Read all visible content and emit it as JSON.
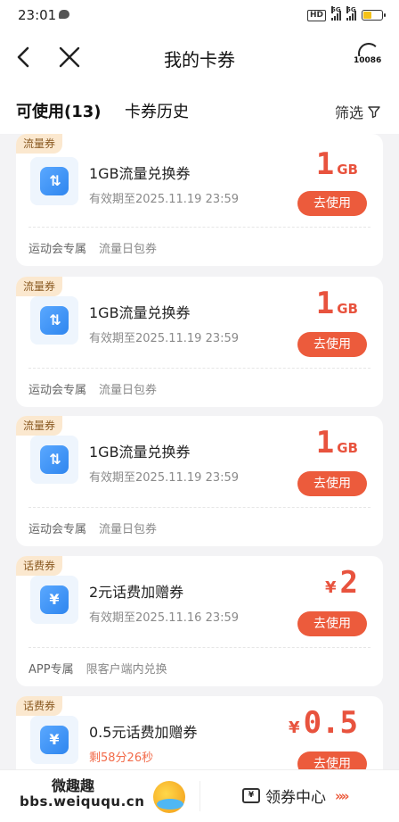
{
  "status_bar": {
    "time": "23:01",
    "hd": "HD",
    "sig1": "5G",
    "sig2": "5G"
  },
  "header": {
    "title": "我的卡券",
    "service_number": "10086"
  },
  "tabs": {
    "active": "可使用(13)",
    "history": "卡券历史",
    "filter": "筛选"
  },
  "cards": [
    {
      "badge": "流量券",
      "icon": "data-transfer-icon",
      "name": "1GB流量兑换券",
      "expiry": "有效期至2025.11.19 23:59",
      "amount": "1",
      "unit": "GB",
      "currency": "",
      "button": "去使用",
      "tag1": "运动会专属",
      "tag2": "流量日包券"
    },
    {
      "badge": "流量券",
      "icon": "data-transfer-icon",
      "name": "1GB流量兑换券",
      "expiry": "有效期至2025.11.19 23:59",
      "amount": "1",
      "unit": "GB",
      "currency": "",
      "button": "去使用",
      "tag1": "运动会专属",
      "tag2": "流量日包券"
    },
    {
      "badge": "流量券",
      "icon": "data-transfer-icon",
      "name": "1GB流量兑换券",
      "expiry": "有效期至2025.11.19 23:59",
      "amount": "1",
      "unit": "GB",
      "currency": "",
      "button": "去使用",
      "tag1": "运动会专属",
      "tag2": "流量日包券"
    },
    {
      "badge": "话费券",
      "icon": "yen-icon",
      "name": "2元话费加赠券",
      "expiry": "有效期至2025.11.16 23:59",
      "amount": "2",
      "unit": "",
      "currency": "¥",
      "button": "去使用",
      "tag1": "APP专属",
      "tag2": "限客户端内兑换"
    },
    {
      "badge": "话费券",
      "icon": "yen-icon",
      "name": "0.5元话费加赠券",
      "expiry": "剩58分26秒",
      "amount": "0.5",
      "unit": "",
      "currency": "¥",
      "button": "去使用",
      "tag1": "",
      "tag2": ""
    }
  ],
  "bottom": {
    "watermark_line1": "微趣趣",
    "watermark_line2": "bbs.weiququ.cn",
    "center_label": "领券中心",
    "center_icon_glyph": "¥",
    "chevrons": "»»"
  },
  "colors": {
    "accent": "#ec5b3c",
    "amount": "#e8533e",
    "badge_bg": "#fbe8cf",
    "icon_blue": "#2f86ef"
  }
}
